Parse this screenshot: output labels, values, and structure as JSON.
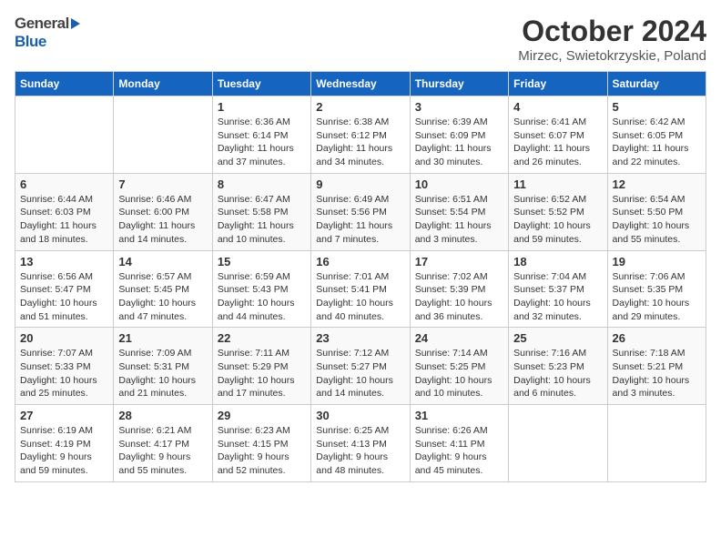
{
  "header": {
    "logo_general": "General",
    "logo_blue": "Blue",
    "month_title": "October 2024",
    "location": "Mirzec, Swietokrzyskie, Poland"
  },
  "weekdays": [
    "Sunday",
    "Monday",
    "Tuesday",
    "Wednesday",
    "Thursday",
    "Friday",
    "Saturday"
  ],
  "weeks": [
    [
      {
        "day": "",
        "sunrise": "",
        "sunset": "",
        "daylight": ""
      },
      {
        "day": "",
        "sunrise": "",
        "sunset": "",
        "daylight": ""
      },
      {
        "day": "1",
        "sunrise": "Sunrise: 6:36 AM",
        "sunset": "Sunset: 6:14 PM",
        "daylight": "Daylight: 11 hours and 37 minutes."
      },
      {
        "day": "2",
        "sunrise": "Sunrise: 6:38 AM",
        "sunset": "Sunset: 6:12 PM",
        "daylight": "Daylight: 11 hours and 34 minutes."
      },
      {
        "day": "3",
        "sunrise": "Sunrise: 6:39 AM",
        "sunset": "Sunset: 6:09 PM",
        "daylight": "Daylight: 11 hours and 30 minutes."
      },
      {
        "day": "4",
        "sunrise": "Sunrise: 6:41 AM",
        "sunset": "Sunset: 6:07 PM",
        "daylight": "Daylight: 11 hours and 26 minutes."
      },
      {
        "day": "5",
        "sunrise": "Sunrise: 6:42 AM",
        "sunset": "Sunset: 6:05 PM",
        "daylight": "Daylight: 11 hours and 22 minutes."
      }
    ],
    [
      {
        "day": "6",
        "sunrise": "Sunrise: 6:44 AM",
        "sunset": "Sunset: 6:03 PM",
        "daylight": "Daylight: 11 hours and 18 minutes."
      },
      {
        "day": "7",
        "sunrise": "Sunrise: 6:46 AM",
        "sunset": "Sunset: 6:00 PM",
        "daylight": "Daylight: 11 hours and 14 minutes."
      },
      {
        "day": "8",
        "sunrise": "Sunrise: 6:47 AM",
        "sunset": "Sunset: 5:58 PM",
        "daylight": "Daylight: 11 hours and 10 minutes."
      },
      {
        "day": "9",
        "sunrise": "Sunrise: 6:49 AM",
        "sunset": "Sunset: 5:56 PM",
        "daylight": "Daylight: 11 hours and 7 minutes."
      },
      {
        "day": "10",
        "sunrise": "Sunrise: 6:51 AM",
        "sunset": "Sunset: 5:54 PM",
        "daylight": "Daylight: 11 hours and 3 minutes."
      },
      {
        "day": "11",
        "sunrise": "Sunrise: 6:52 AM",
        "sunset": "Sunset: 5:52 PM",
        "daylight": "Daylight: 10 hours and 59 minutes."
      },
      {
        "day": "12",
        "sunrise": "Sunrise: 6:54 AM",
        "sunset": "Sunset: 5:50 PM",
        "daylight": "Daylight: 10 hours and 55 minutes."
      }
    ],
    [
      {
        "day": "13",
        "sunrise": "Sunrise: 6:56 AM",
        "sunset": "Sunset: 5:47 PM",
        "daylight": "Daylight: 10 hours and 51 minutes."
      },
      {
        "day": "14",
        "sunrise": "Sunrise: 6:57 AM",
        "sunset": "Sunset: 5:45 PM",
        "daylight": "Daylight: 10 hours and 47 minutes."
      },
      {
        "day": "15",
        "sunrise": "Sunrise: 6:59 AM",
        "sunset": "Sunset: 5:43 PM",
        "daylight": "Daylight: 10 hours and 44 minutes."
      },
      {
        "day": "16",
        "sunrise": "Sunrise: 7:01 AM",
        "sunset": "Sunset: 5:41 PM",
        "daylight": "Daylight: 10 hours and 40 minutes."
      },
      {
        "day": "17",
        "sunrise": "Sunrise: 7:02 AM",
        "sunset": "Sunset: 5:39 PM",
        "daylight": "Daylight: 10 hours and 36 minutes."
      },
      {
        "day": "18",
        "sunrise": "Sunrise: 7:04 AM",
        "sunset": "Sunset: 5:37 PM",
        "daylight": "Daylight: 10 hours and 32 minutes."
      },
      {
        "day": "19",
        "sunrise": "Sunrise: 7:06 AM",
        "sunset": "Sunset: 5:35 PM",
        "daylight": "Daylight: 10 hours and 29 minutes."
      }
    ],
    [
      {
        "day": "20",
        "sunrise": "Sunrise: 7:07 AM",
        "sunset": "Sunset: 5:33 PM",
        "daylight": "Daylight: 10 hours and 25 minutes."
      },
      {
        "day": "21",
        "sunrise": "Sunrise: 7:09 AM",
        "sunset": "Sunset: 5:31 PM",
        "daylight": "Daylight: 10 hours and 21 minutes."
      },
      {
        "day": "22",
        "sunrise": "Sunrise: 7:11 AM",
        "sunset": "Sunset: 5:29 PM",
        "daylight": "Daylight: 10 hours and 17 minutes."
      },
      {
        "day": "23",
        "sunrise": "Sunrise: 7:12 AM",
        "sunset": "Sunset: 5:27 PM",
        "daylight": "Daylight: 10 hours and 14 minutes."
      },
      {
        "day": "24",
        "sunrise": "Sunrise: 7:14 AM",
        "sunset": "Sunset: 5:25 PM",
        "daylight": "Daylight: 10 hours and 10 minutes."
      },
      {
        "day": "25",
        "sunrise": "Sunrise: 7:16 AM",
        "sunset": "Sunset: 5:23 PM",
        "daylight": "Daylight: 10 hours and 6 minutes."
      },
      {
        "day": "26",
        "sunrise": "Sunrise: 7:18 AM",
        "sunset": "Sunset: 5:21 PM",
        "daylight": "Daylight: 10 hours and 3 minutes."
      }
    ],
    [
      {
        "day": "27",
        "sunrise": "Sunrise: 6:19 AM",
        "sunset": "Sunset: 4:19 PM",
        "daylight": "Daylight: 9 hours and 59 minutes."
      },
      {
        "day": "28",
        "sunrise": "Sunrise: 6:21 AM",
        "sunset": "Sunset: 4:17 PM",
        "daylight": "Daylight: 9 hours and 55 minutes."
      },
      {
        "day": "29",
        "sunrise": "Sunrise: 6:23 AM",
        "sunset": "Sunset: 4:15 PM",
        "daylight": "Daylight: 9 hours and 52 minutes."
      },
      {
        "day": "30",
        "sunrise": "Sunrise: 6:25 AM",
        "sunset": "Sunset: 4:13 PM",
        "daylight": "Daylight: 9 hours and 48 minutes."
      },
      {
        "day": "31",
        "sunrise": "Sunrise: 6:26 AM",
        "sunset": "Sunset: 4:11 PM",
        "daylight": "Daylight: 9 hours and 45 minutes."
      },
      {
        "day": "",
        "sunrise": "",
        "sunset": "",
        "daylight": ""
      },
      {
        "day": "",
        "sunrise": "",
        "sunset": "",
        "daylight": ""
      }
    ]
  ]
}
